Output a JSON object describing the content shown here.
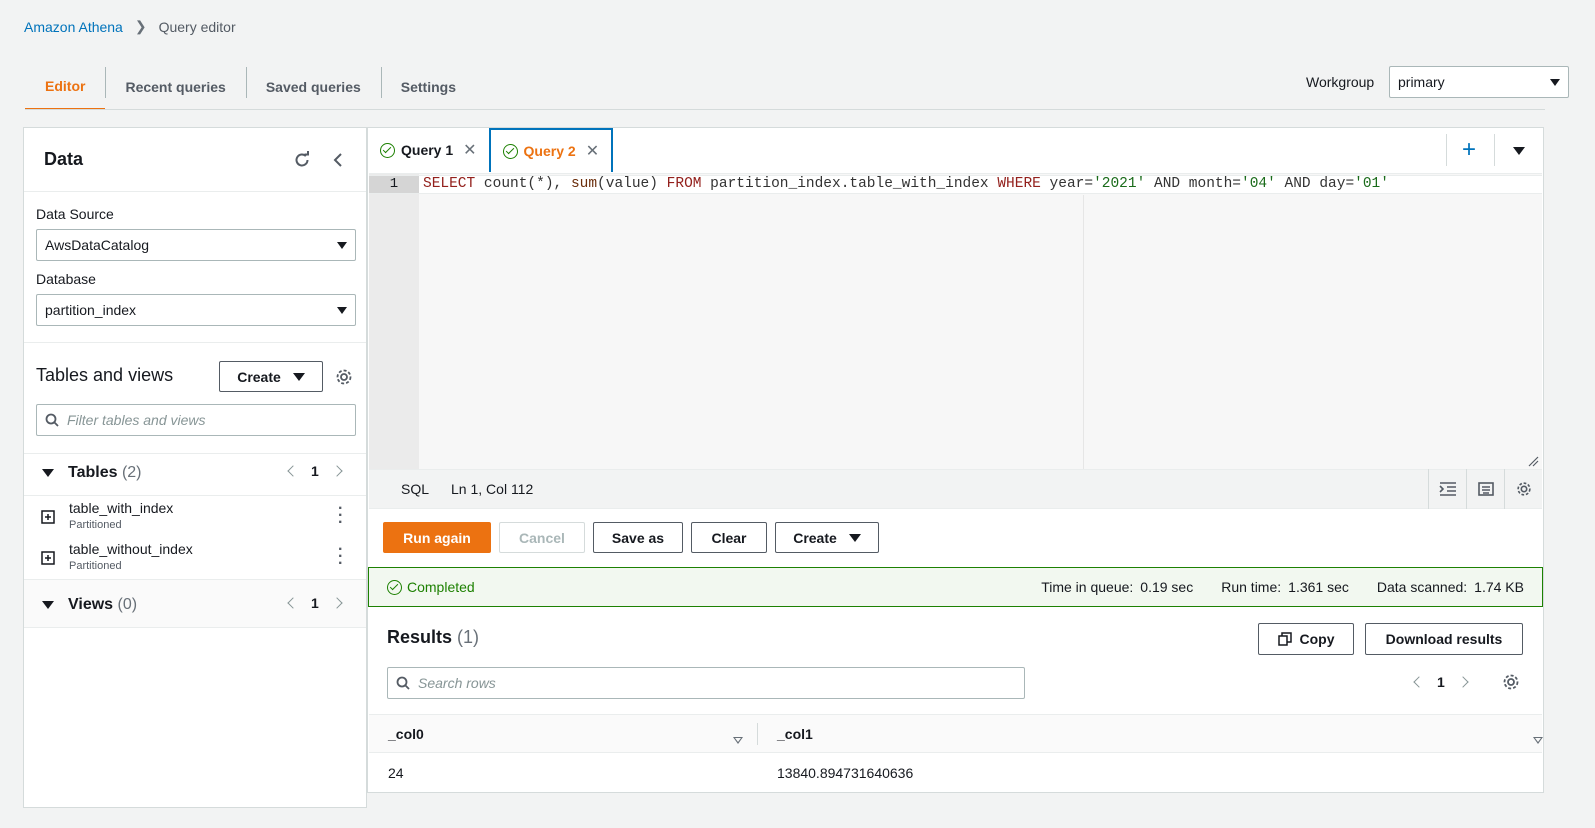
{
  "breadcrumb": {
    "root": "Amazon Athena",
    "current": "Query editor"
  },
  "nav_tabs": [
    "Editor",
    "Recent queries",
    "Saved queries",
    "Settings"
  ],
  "workgroup": {
    "label": "Workgroup",
    "value": "primary"
  },
  "left": {
    "title": "Data",
    "data_source_label": "Data Source",
    "data_source_value": "AwsDataCatalog",
    "database_label": "Database",
    "database_value": "partition_index",
    "tables_views_title": "Tables and views",
    "create_label": "Create",
    "filter_placeholder": "Filter tables and views",
    "tables_label": "Tables",
    "tables_count": "(2)",
    "tables_page": "1",
    "tables": [
      {
        "name": "table_with_index",
        "sub": "Partitioned"
      },
      {
        "name": "table_without_index",
        "sub": "Partitioned"
      }
    ],
    "views_label": "Views",
    "views_count": "(0)",
    "views_page": "1"
  },
  "query_tabs": [
    "Query 1",
    "Query 2"
  ],
  "editor": {
    "line_number": "1",
    "sql": {
      "t1": "SELECT",
      "t2": " count(*), ",
      "t3": "sum",
      "t4": "(value) ",
      "t5": "FROM",
      "t6": " partition_index.table_with_index ",
      "t7": "WHERE",
      "t8": " year=",
      "t9": "'2021'",
      "t10": " AND month=",
      "t11": "'04'",
      "t12": " AND day=",
      "t13": "'01'"
    },
    "language": "SQL",
    "cursor": "Ln 1, Col 112"
  },
  "actions": {
    "run": "Run again",
    "cancel": "Cancel",
    "save_as": "Save as",
    "clear": "Clear",
    "create": "Create"
  },
  "status": {
    "state": "Completed",
    "queue_label": "Time in queue:",
    "queue_value": "0.19 sec",
    "run_label": "Run time:",
    "run_value": "1.361 sec",
    "scanned_label": "Data scanned:",
    "scanned_value": "1.74 KB"
  },
  "results": {
    "title": "Results",
    "count": "(1)",
    "copy": "Copy",
    "download": "Download results",
    "search_placeholder": "Search rows",
    "page": "1",
    "columns": [
      "_col0",
      "_col1"
    ],
    "rows": [
      [
        "24",
        "13840.894731640636"
      ]
    ]
  },
  "colors": {
    "accent": "#ec7211",
    "link": "#0073bb",
    "success": "#1d8102"
  }
}
